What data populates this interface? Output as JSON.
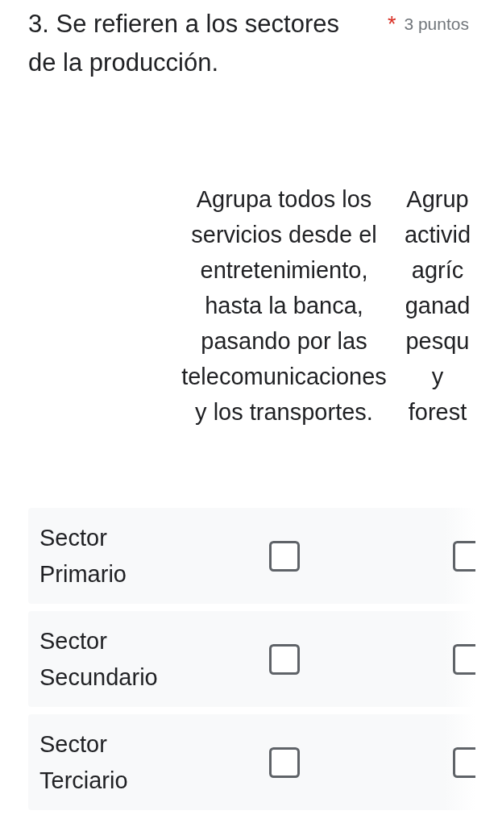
{
  "question": {
    "title": "3. Se refieren a los sectores de la producción.",
    "required_mark": "*",
    "points": "3 puntos"
  },
  "grid": {
    "columns": [
      {
        "lines": [
          "Agrupa todos los",
          "servicios desde el",
          "entretenimiento,",
          "hasta la banca,",
          "pasando por las",
          "telecomunicaciones",
          "y los transportes."
        ]
      },
      {
        "lines": [
          "Agrup",
          "activid",
          "agríc",
          "ganad",
          "pesqu",
          "y",
          "forest"
        ]
      }
    ],
    "rows": [
      {
        "label": "Sector Primario",
        "cells": [
          {
            "checked": false
          },
          {
            "checked": false
          }
        ]
      },
      {
        "label": "Sector Secundario",
        "cells": [
          {
            "checked": false
          },
          {
            "checked": false
          }
        ]
      },
      {
        "label": "Sector Terciario",
        "cells": [
          {
            "checked": false
          },
          {
            "checked": false
          }
        ]
      }
    ]
  }
}
